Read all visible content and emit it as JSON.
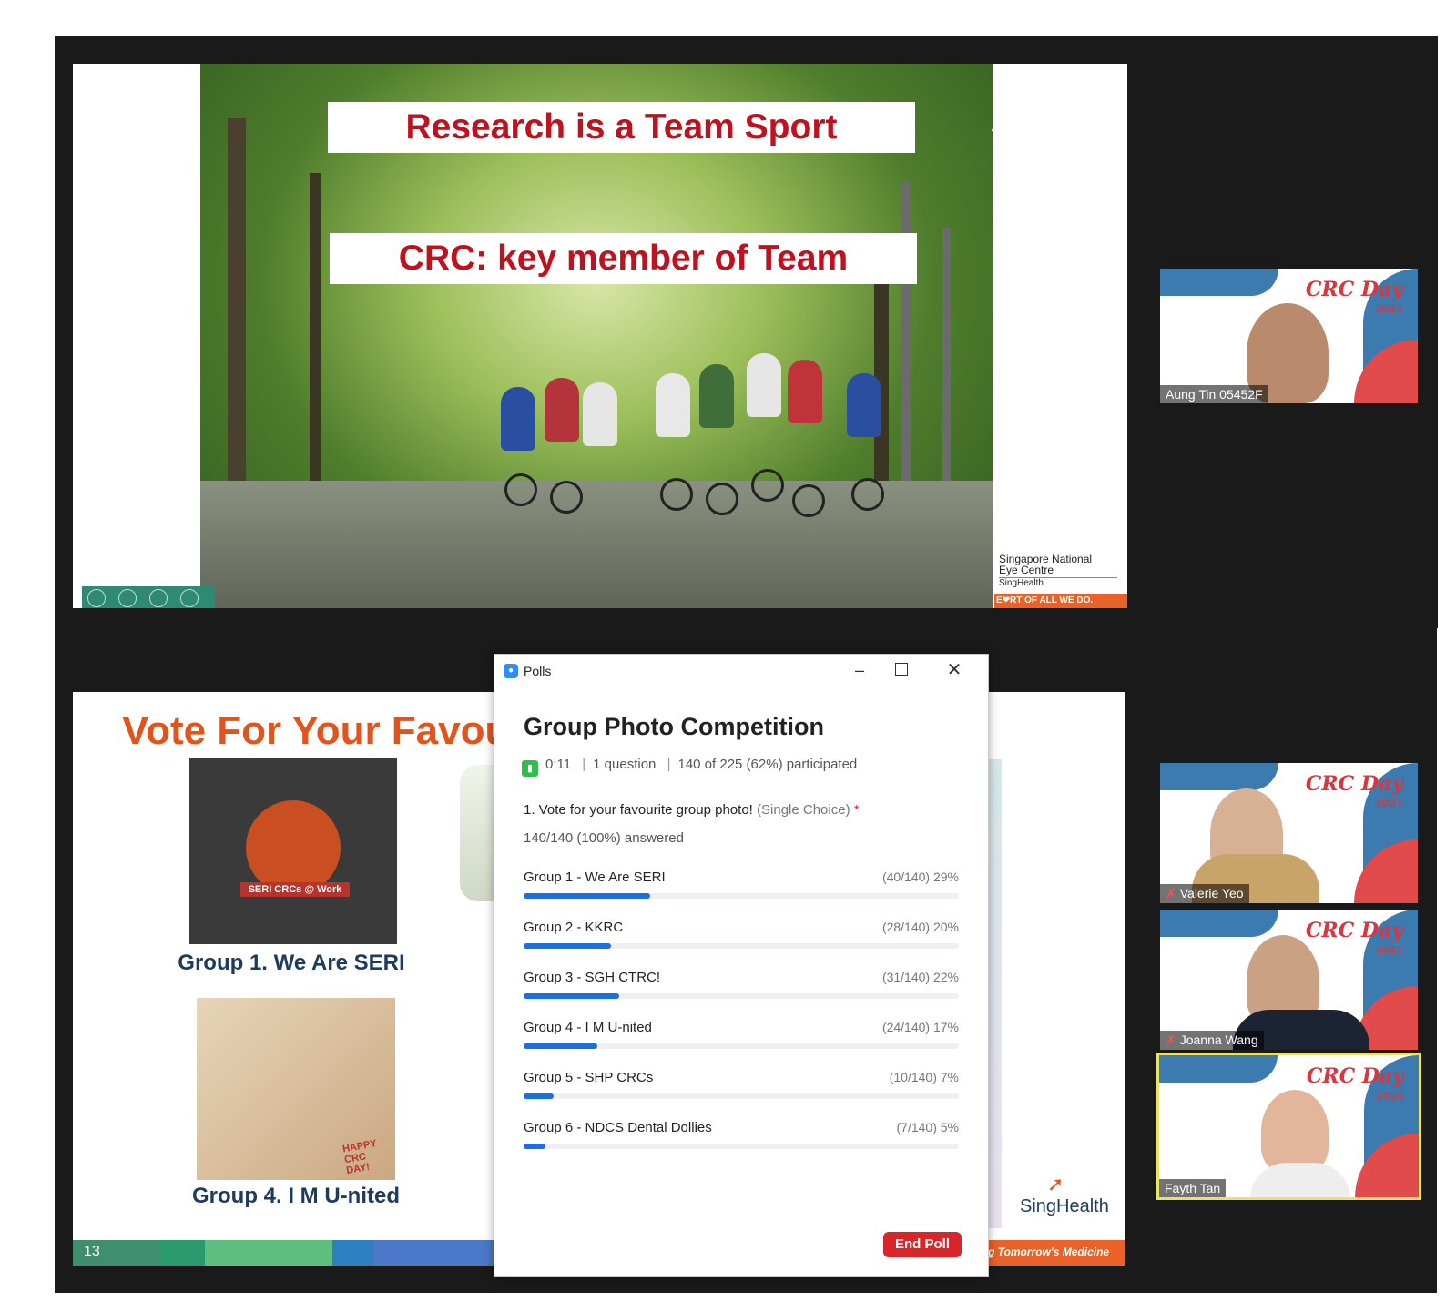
{
  "top_slide": {
    "banner_1": "Research is a Team Sport",
    "banner_2": "CRC: key member of Team",
    "logo_line1": "Singapore National",
    "logo_line2": "Eye Centre",
    "logo_line3": "SingHealth",
    "strip": "E❤RT OF ALL WE DO."
  },
  "participants": [
    {
      "name": "Aung Tin 05452F",
      "muted": false
    },
    {
      "name": "Valerie Yeo",
      "muted": true
    },
    {
      "name": "Joanna Wang",
      "muted": true
    },
    {
      "name": "Fayth Tan",
      "muted": false,
      "active_speaker": true
    }
  ],
  "tile_brand": {
    "line1": "CRC Day",
    "line2": "2021"
  },
  "bottom_slide": {
    "heading": "Vote For Your Favou",
    "group1_caption": "Group 1. We Are SERI",
    "group1_grid_label": "SERI CRCs @ Work",
    "group4_caption": "Group 4. I M U-nited",
    "group4_sign": "HAPPY CRC DAY!",
    "slide_number": "13",
    "logo": "SingHealth",
    "footer_right": "g Tomorrow's Medicine"
  },
  "poll": {
    "window_title": "Polls",
    "title": "Group Photo Competition",
    "time": "0:11",
    "questions": "1 question",
    "participation": "140 of 225 (62%) participated",
    "question": "1. Vote for your favourite group photo!",
    "question_type": "(Single Choice)",
    "required_mark": "*",
    "answered": "140/140 (100%) answered",
    "options": [
      {
        "label": "Group 1 - We Are SERI",
        "count": "(40/140) 29%",
        "percent": 29
      },
      {
        "label": "Group 2 - KKRC",
        "count": "(28/140) 20%",
        "percent": 20
      },
      {
        "label": "Group 3 - SGH CTRC!",
        "count": "(31/140) 22%",
        "percent": 22
      },
      {
        "label": "Group 4 - I M U-nited",
        "count": "(24/140) 17%",
        "percent": 17
      },
      {
        "label": "Group 5 - SHP CRCs",
        "count": "(10/140) 7%",
        "percent": 7
      },
      {
        "label": "Group 6 - NDCS Dental Dollies",
        "count": "(7/140) 5%",
        "percent": 5
      }
    ],
    "end_button": "End Poll"
  },
  "colors": {
    "accent_blue": "#1b6fe0",
    "end_red": "#d9262b",
    "banner_red": "#c0111f",
    "vote_orange": "#e3541d",
    "speaker_border": "#e8e26a"
  }
}
